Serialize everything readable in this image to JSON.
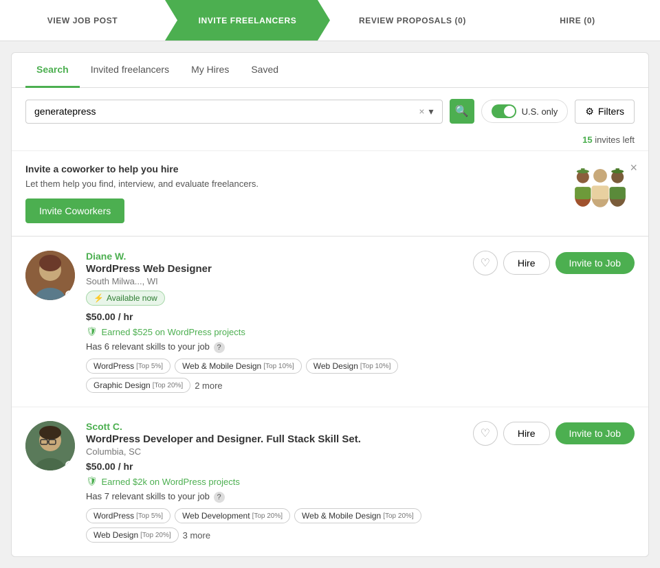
{
  "progressSteps": [
    {
      "id": "view-job-post",
      "label": "View Job Post",
      "active": false
    },
    {
      "id": "invite-freelancers",
      "label": "Invite Freelancers",
      "active": true
    },
    {
      "id": "review-proposals",
      "label": "Review Proposals (0)",
      "active": false
    },
    {
      "id": "hire",
      "label": "Hire (0)",
      "active": false
    }
  ],
  "tabs": [
    {
      "id": "search",
      "label": "Search",
      "active": true
    },
    {
      "id": "invited-freelancers",
      "label": "Invited freelancers",
      "active": false
    },
    {
      "id": "my-hires",
      "label": "My Hires",
      "active": false
    },
    {
      "id": "saved",
      "label": "Saved",
      "active": false
    }
  ],
  "search": {
    "value": "generatepress",
    "clearIcon": "×",
    "dropdownIcon": "▾",
    "searchIcon": "🔍"
  },
  "toggleLabel": "U.S. only",
  "filtersLabel": "Filters",
  "invitesLeft": {
    "count": "15",
    "text": "invites left"
  },
  "banner": {
    "title": "Invite a coworker to help you hire",
    "description": "Let them help you find, interview, and evaluate freelancers.",
    "buttonLabel": "Invite Coworkers"
  },
  "freelancers": [
    {
      "id": "diane-w",
      "name": "Diane W.",
      "title": "WordPress Web Designer",
      "location": "South Milwa..., WI",
      "available": true,
      "availableLabel": "Available now",
      "rate": "$50.00 / hr",
      "earned": "Earned $525 on WordPress projects",
      "relevantSkillsCount": "6",
      "skills": [
        {
          "name": "WordPress",
          "rank": "Top 5%"
        },
        {
          "name": "Web & Mobile Design",
          "rank": "Top 10%"
        },
        {
          "name": "Web Design",
          "rank": "Top 10%"
        },
        {
          "name": "Graphic Design",
          "rank": "Top 20%"
        }
      ],
      "moreSkills": "2 more",
      "hireLabel": "Hire",
      "inviteLabel": "Invite to Job",
      "avatarBg": "#8B5E3C"
    },
    {
      "id": "scott-c",
      "name": "Scott C.",
      "title": "WordPress Developer and Designer. Full Stack Skill Set.",
      "location": "Columbia, SC",
      "available": false,
      "availableLabel": "",
      "rate": "$50.00 / hr",
      "earned": "Earned $2k on WordPress projects",
      "relevantSkillsCount": "7",
      "skills": [
        {
          "name": "WordPress",
          "rank": "Top 5%"
        },
        {
          "name": "Web Development",
          "rank": "Top 20%"
        },
        {
          "name": "Web & Mobile Design",
          "rank": "Top 20%"
        },
        {
          "name": "Web Design",
          "rank": "Top 20%"
        }
      ],
      "moreSkills": "3 more",
      "hireLabel": "Hire",
      "inviteLabel": "Invite to Job",
      "avatarBg": "#5a7a5a"
    }
  ]
}
